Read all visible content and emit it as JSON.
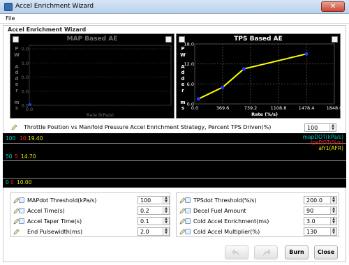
{
  "window": {
    "title": "Accel Enrichment Wizard",
    "close_glyph": "✕"
  },
  "menu": {
    "file": "File"
  },
  "group_title": "Accel Enrichment Wizard",
  "left_chart": {
    "title": "MAP Based AE",
    "ylabel_letters": [
      "P",
      "W",
      "",
      "A",
      "d",
      "d",
      "e",
      "r",
      "",
      "m",
      "s"
    ],
    "xlabel": "Rate (kPa/s)",
    "yticks": [
      "0.0",
      "0.0",
      "0.0",
      "0.0",
      "0.0"
    ],
    "xticks": [
      "0.0"
    ]
  },
  "right_chart": {
    "title": "TPS Based AE",
    "ylabel_letters": [
      "P",
      "W",
      "",
      "A",
      "d",
      "d",
      "e",
      "r",
      "",
      "m",
      "s"
    ],
    "xlabel": "Rate (%/s)",
    "yticks": [
      "18.0",
      "12.0",
      "6.0",
      "0.0"
    ],
    "xticks": [
      "0.0",
      "369.6",
      "739.2",
      "1108.8",
      "1478.4",
      "1848.0"
    ]
  },
  "chart_data": [
    {
      "type": "line",
      "title": "MAP Based AE",
      "xlabel": "Rate (kPa/s)",
      "ylabel": "PW Adder ms",
      "x": [
        0.0
      ],
      "y": [
        0.0
      ],
      "xlim": [
        0,
        0
      ],
      "ylim": [
        0,
        0
      ]
    },
    {
      "type": "line",
      "title": "TPS Based AE",
      "xlabel": "Rate (%/s)",
      "ylabel": "PW Adder ms",
      "x": [
        50,
        369.6,
        650,
        1478.4
      ],
      "y": [
        1.5,
        5.0,
        10.5,
        15.0
      ],
      "xlim": [
        0,
        1848.0
      ],
      "ylim": [
        0,
        18.0
      ],
      "line_color": "#ffff00",
      "point_color": "#1e3cff"
    }
  ],
  "strategy": {
    "label": "Throttle Position vs Manifold Pressure Accel Enrichment Strategy, Percent TPS Driven(%)",
    "value": "100"
  },
  "strip_chart": {
    "top_left": [
      "100",
      "10",
      "19.40"
    ],
    "mid_left": [
      "50",
      "5",
      "14.70"
    ],
    "bottom_left": [
      "0",
      "0",
      "10.00"
    ],
    "legend": [
      "mapDOT(kPa/s)",
      "tpsDOT(%/s)",
      "afr1(AFR)"
    ],
    "colors": [
      "#00c8c8",
      "#ff2020",
      "#e8e800"
    ]
  },
  "left_params": [
    {
      "label": "MAPdot Threshold(kPa/s)",
      "value": "100"
    },
    {
      "label": "Accel Time(s)",
      "value": "0.2"
    },
    {
      "label": "Accel Taper Time(s)",
      "value": "0.1"
    },
    {
      "label": "End Pulsewidth(ms)",
      "value": "2.0"
    }
  ],
  "right_params": [
    {
      "label": "TPSdot Threshold(%/s)",
      "value": "200.0"
    },
    {
      "label": "Decel Fuel Amount",
      "value": "90"
    },
    {
      "label": "Cold Accel Enrichment(ms)",
      "value": "3.0"
    },
    {
      "label": "Cold Accel Multiplier(%)",
      "value": "130"
    }
  ],
  "buttons": {
    "burn": "Burn",
    "close": "Close"
  }
}
